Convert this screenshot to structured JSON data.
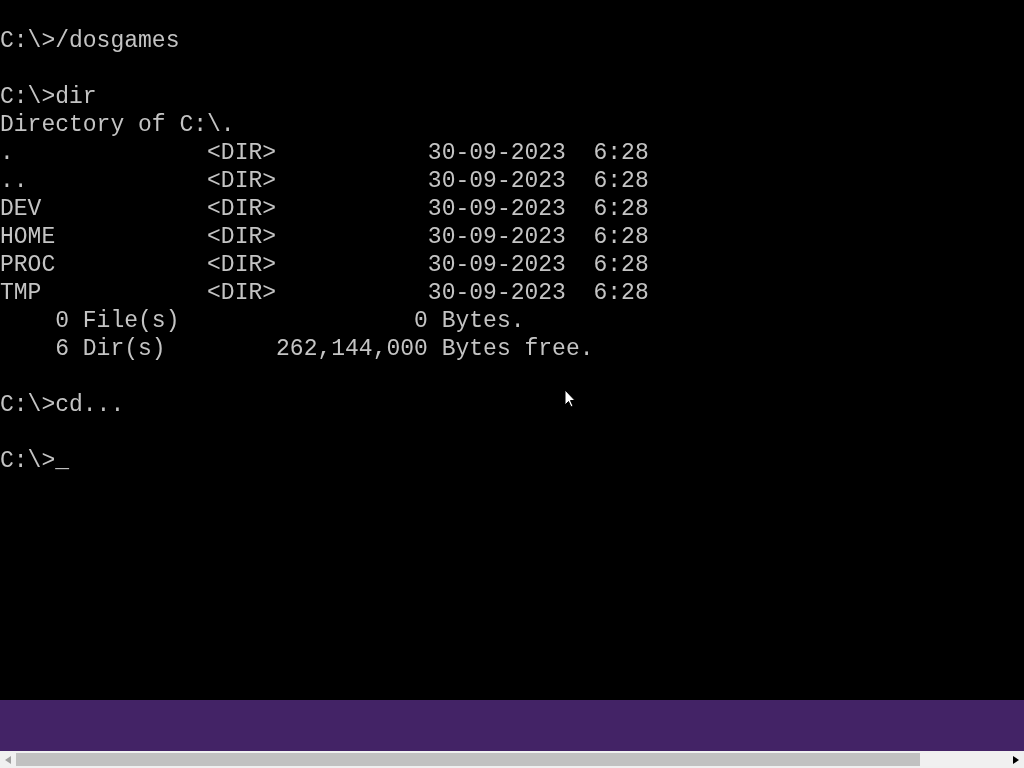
{
  "terminal": {
    "blocks": [
      {
        "lines": [
          "C:\\>/dosgames"
        ]
      },
      {
        "lines": [
          "C:\\>dir",
          "Directory of C:\\.",
          ".              <DIR>           30-09-2023  6:28",
          "..             <DIR>           30-09-2023  6:28",
          "DEV            <DIR>           30-09-2023  6:28",
          "HOME           <DIR>           30-09-2023  6:28",
          "PROC           <DIR>           30-09-2023  6:28",
          "TMP            <DIR>           30-09-2023  6:28",
          "    0 File(s)                 0 Bytes.",
          "    6 Dir(s)        262,144,000 Bytes free."
        ]
      },
      {
        "lines": [
          "C:\\>cd..."
        ]
      },
      {
        "lines": [
          "C:\\>_"
        ]
      }
    ]
  }
}
